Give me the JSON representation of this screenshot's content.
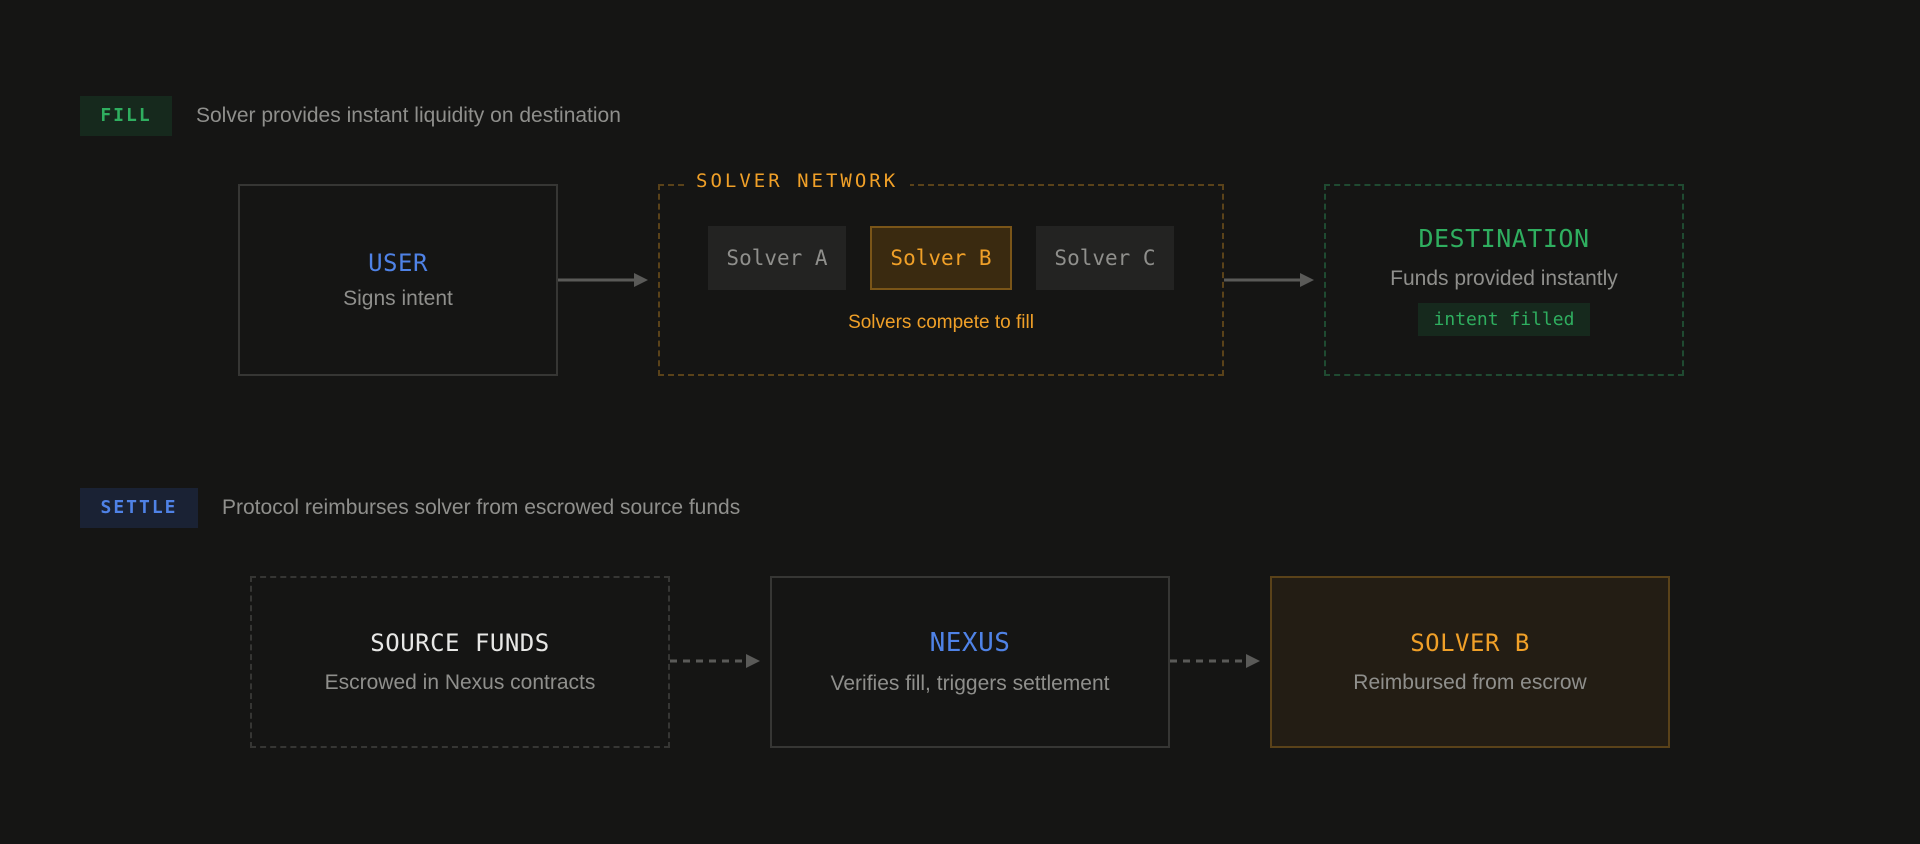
{
  "fill_section": {
    "tag": "FILL",
    "description": "Solver provides instant liquidity on destination",
    "user": {
      "title": "USER",
      "subtitle": "Signs intent"
    },
    "network": {
      "label": "SOLVER NETWORK",
      "solvers": [
        "Solver A",
        "Solver B",
        "Solver C"
      ],
      "caption": "Solvers compete to fill"
    },
    "destination": {
      "title": "DESTINATION",
      "subtitle": "Funds provided instantly",
      "badge": "intent filled"
    }
  },
  "settle_section": {
    "tag": "SETTLE",
    "description": "Protocol reimburses solver from escrowed source funds",
    "source": {
      "title": "SOURCE FUNDS",
      "subtitle": "Escrowed in Nexus contracts"
    },
    "nexus": {
      "title": "NEXUS",
      "subtitle": "Verifies fill, triggers settlement"
    },
    "solver_b": {
      "title": "SOLVER B",
      "subtitle": "Reimbursed from escrow"
    }
  },
  "colors": {
    "background": "#151514",
    "green": "#2fae5f",
    "blue": "#4f82e6",
    "orange": "#f0a028",
    "muted_text": "#8f8f8c"
  }
}
